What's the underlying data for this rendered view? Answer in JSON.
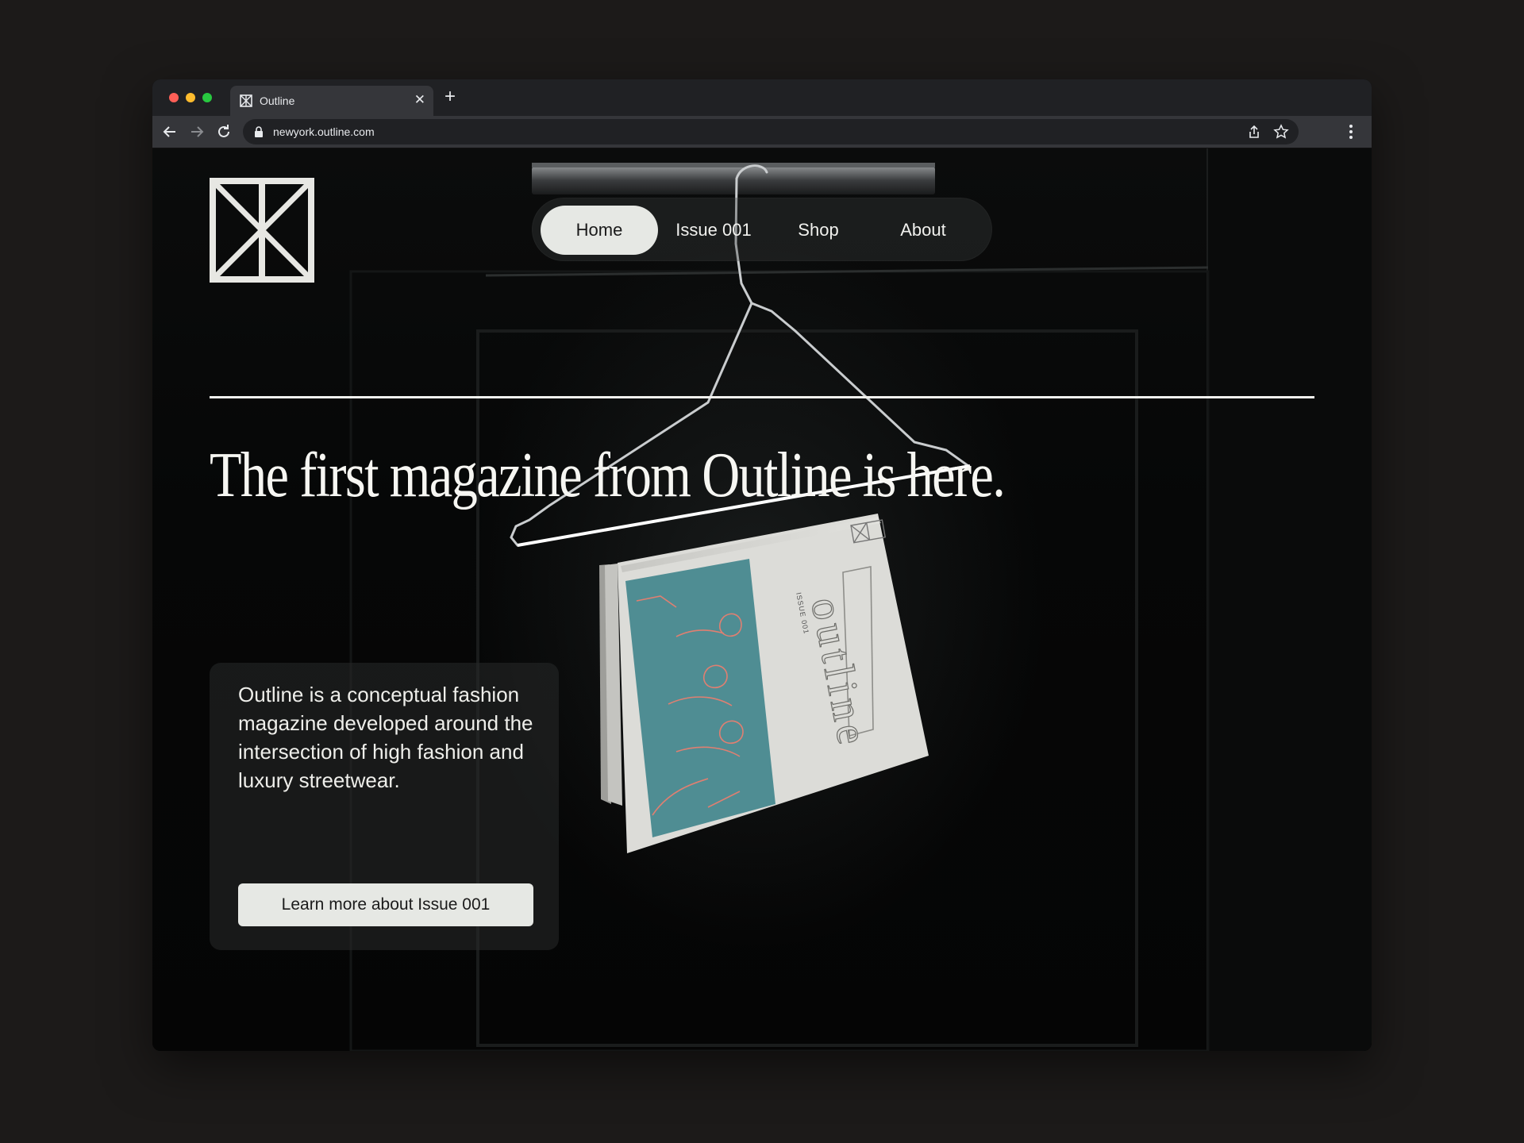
{
  "browser": {
    "tab_title": "Outline",
    "url": "newyork.outline.com"
  },
  "nav": {
    "items": [
      {
        "label": "Home",
        "active": true
      },
      {
        "label": "Issue 001",
        "active": false
      },
      {
        "label": "Shop",
        "active": false
      },
      {
        "label": "About",
        "active": false
      }
    ]
  },
  "hero": {
    "headline": "The first magazine from Outline is here."
  },
  "intro_card": {
    "text": "Outline is a conceptual fashion magazine developed around the intersection of high fashion and luxury streetwear.",
    "button_label": "Learn more about Issue 001"
  },
  "magazine": {
    "cover_title": "outline",
    "issue_label": "ISSUE 001"
  },
  "colors": {
    "page_background": "#050505",
    "nav_active_pill": "#e6e8e4",
    "cover_paper": "#dcdcd8",
    "cover_art": "#4f8d93",
    "cover_lines": "#e07f71"
  }
}
